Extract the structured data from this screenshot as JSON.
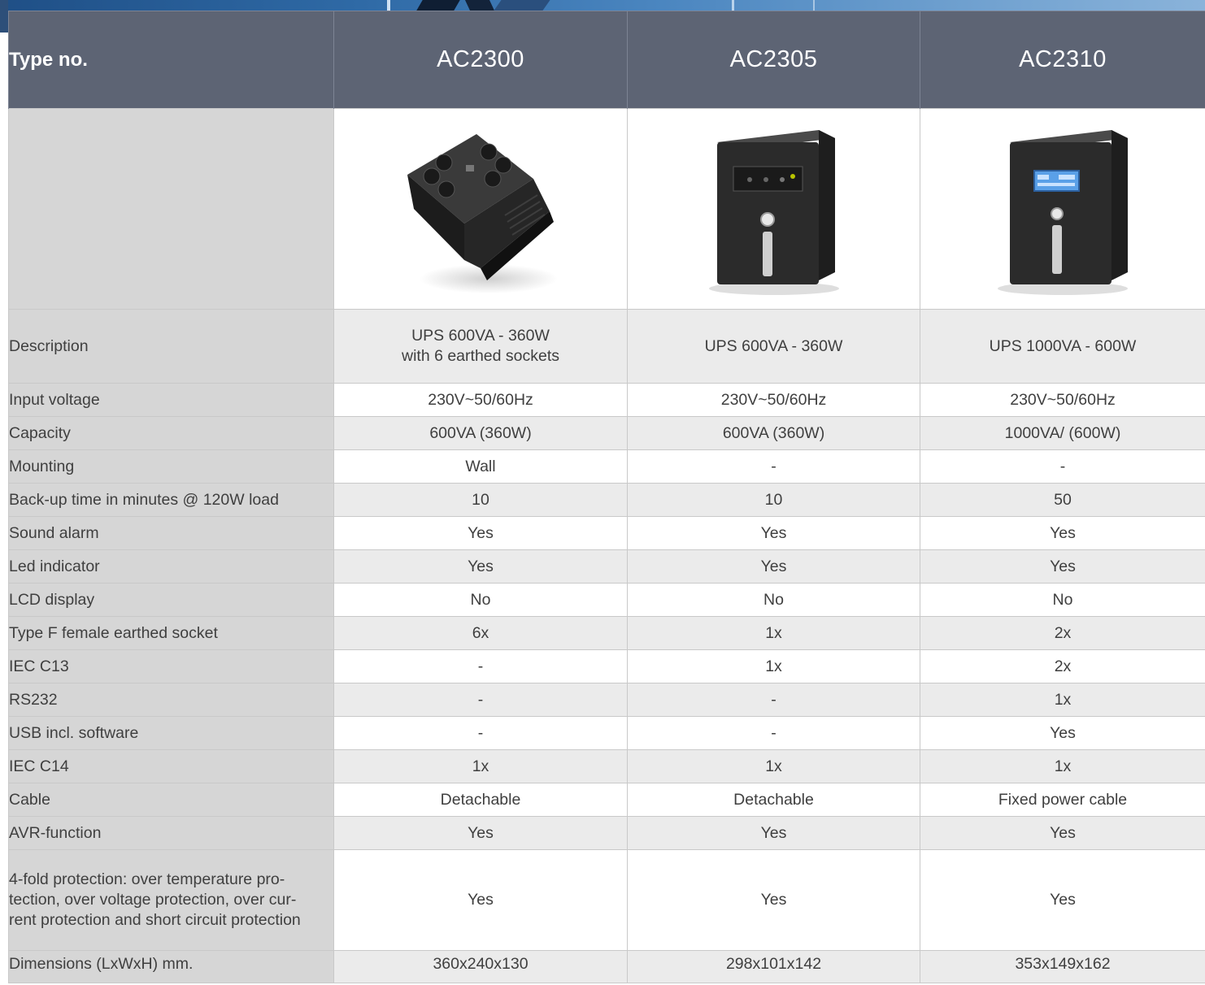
{
  "header": {
    "type_label": "Type no.",
    "models": [
      "AC2300",
      "AC2305",
      "AC2310"
    ]
  },
  "products": [
    {
      "image": "ups-power-strip-6-sockets"
    },
    {
      "image": "ups-tower-led-panel"
    },
    {
      "image": "ups-tower-lcd-panel"
    }
  ],
  "rows": [
    {
      "label": "Description",
      "values": [
        "UPS 600VA - 360W|with 6 earthed sockets",
        "UPS 600VA - 360W",
        "UPS 1000VA - 600W"
      ]
    },
    {
      "label": "Input voltage",
      "values": [
        "230V~50/60Hz",
        "230V~50/60Hz",
        "230V~50/60Hz"
      ]
    },
    {
      "label": "Capacity",
      "values": [
        "600VA (360W)",
        "600VA (360W)",
        "1000VA/ (600W)"
      ]
    },
    {
      "label": "Mounting",
      "values": [
        "Wall",
        "-",
        "-"
      ]
    },
    {
      "label": "Back-up time in minutes @ 120W load",
      "values": [
        "10",
        "10",
        "50"
      ]
    },
    {
      "label": "Sound alarm",
      "values": [
        "Yes",
        "Yes",
        "Yes"
      ]
    },
    {
      "label": "Led indicator",
      "values": [
        "Yes",
        "Yes",
        "Yes"
      ]
    },
    {
      "label": "LCD display",
      "values": [
        "No",
        "No",
        "No"
      ]
    },
    {
      "label": "Type F female earthed socket",
      "values": [
        "6x",
        "1x",
        "2x"
      ]
    },
    {
      "label": "IEC C13",
      "values": [
        "-",
        "1x",
        "2x"
      ]
    },
    {
      "label": "RS232",
      "values": [
        "-",
        "-",
        "1x"
      ]
    },
    {
      "label": "USB incl. software",
      "values": [
        "-",
        "-",
        "Yes"
      ]
    },
    {
      "label": "IEC C14",
      "values": [
        "1x",
        "1x",
        "1x"
      ]
    },
    {
      "label": "Cable",
      "values": [
        "Detachable",
        "Detachable",
        "Fixed power cable"
      ]
    },
    {
      "label": "AVR-function",
      "values": [
        "Yes",
        "Yes",
        "Yes"
      ]
    },
    {
      "label": "4-fold protection: over temperature pro-|tection, over voltage protection, over cur-|rent protection and short circuit protection",
      "values": [
        "Yes",
        "Yes",
        "Yes"
      ]
    },
    {
      "label": "Dimensions (LxWxH) mm.",
      "values": [
        "360x240x130",
        "298x101x142",
        "353x149x162"
      ]
    }
  ]
}
